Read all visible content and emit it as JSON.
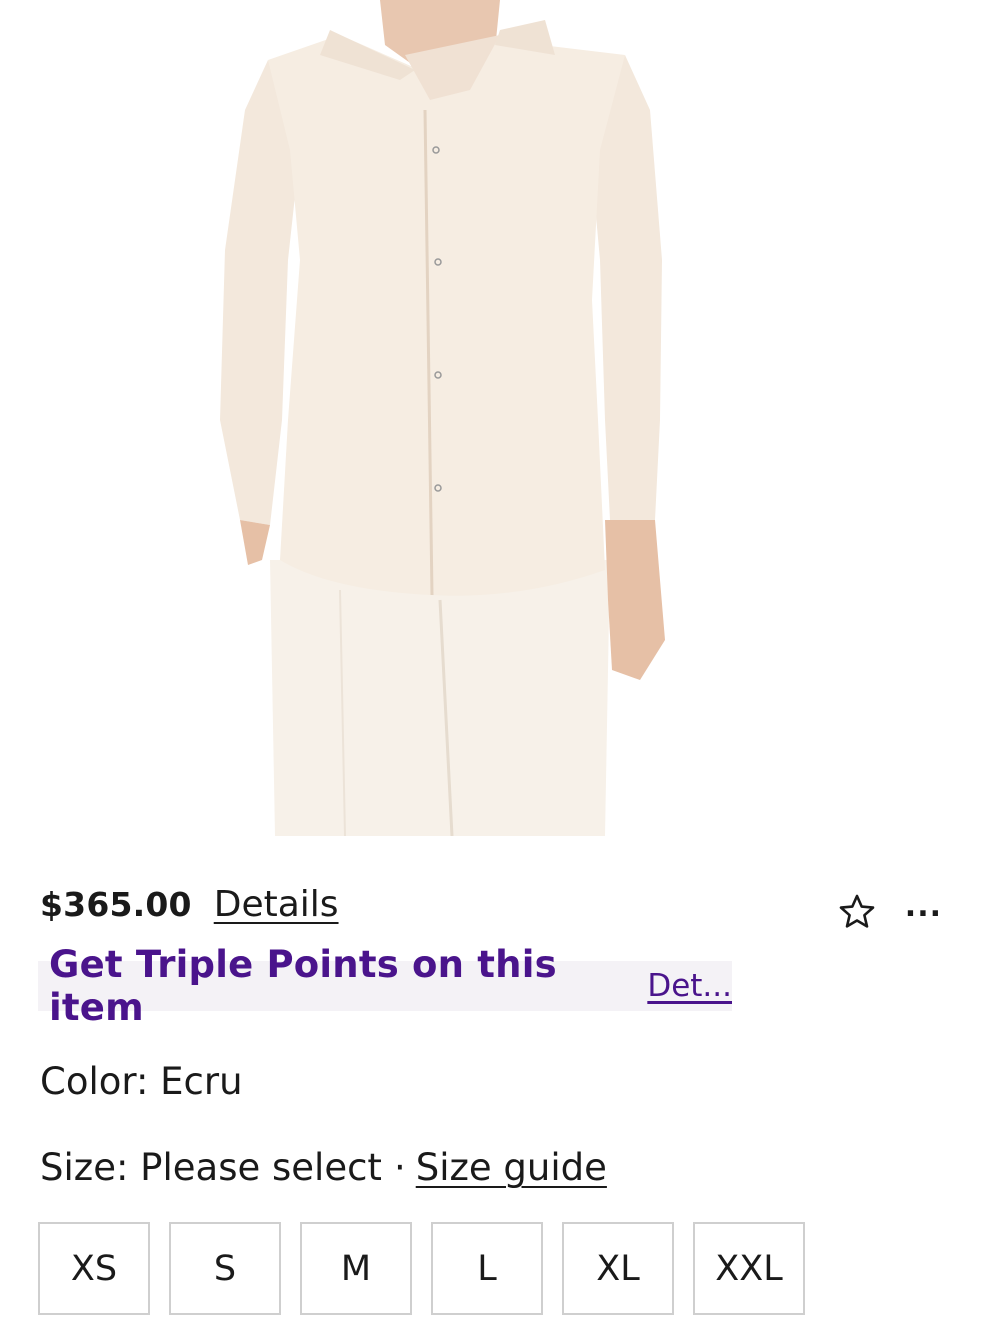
{
  "product": {
    "image_alt": "Ecru button-up overshirt",
    "price": "$365.00",
    "details_label": "Details"
  },
  "actions": {
    "favorite_icon": "star-outline-icon",
    "more_label": "..."
  },
  "promo": {
    "text": "Get Triple Points on this item",
    "link_label": "Det..."
  },
  "color": {
    "label": "Color: Ecru"
  },
  "size": {
    "label": "Size: Please select",
    "separator": "·",
    "guide_label": "Size guide",
    "options": [
      "XS",
      "S",
      "M",
      "L",
      "XL",
      "XXL"
    ]
  },
  "colors": {
    "promo_text": "#4a148c",
    "promo_bg": "#f4f2f6",
    "garment": "#f5ece1"
  }
}
